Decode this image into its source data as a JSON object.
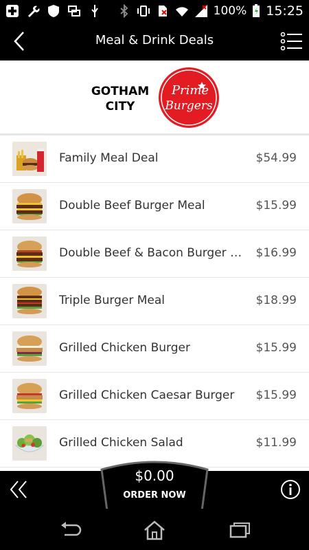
{
  "status": {
    "battery": "100%",
    "time": "15:25"
  },
  "header": {
    "title": "Meal & Drink Deals",
    "city": "GOTHAM CITY",
    "logo_text_line1": "Prime",
    "logo_text_line2": "Burgers"
  },
  "items": [
    {
      "name": "Family Meal Deal",
      "price": "$54.99",
      "thumb": "meal-combo"
    },
    {
      "name": "Double Beef Burger Meal",
      "price": "$15.99",
      "thumb": "burger"
    },
    {
      "name": "Double Beef & Bacon Burger M...",
      "price": "$16.99",
      "thumb": "burger"
    },
    {
      "name": "Triple Burger Meal",
      "price": "$18.99",
      "thumb": "burger"
    },
    {
      "name": "Grilled Chicken Burger",
      "price": "$15.99",
      "thumb": "burger"
    },
    {
      "name": "Grilled Chicken Caesar Burger",
      "price": "$15.99",
      "thumb": "burger"
    },
    {
      "name": "Grilled Chicken Salad",
      "price": "$11.99",
      "thumb": "salad"
    }
  ],
  "order": {
    "amount": "$0.00",
    "label": "ORDER NOW"
  },
  "colors": {
    "brand_red": "#e31b23",
    "bar_bg": "#000000",
    "list_bg": "#ffffff"
  }
}
